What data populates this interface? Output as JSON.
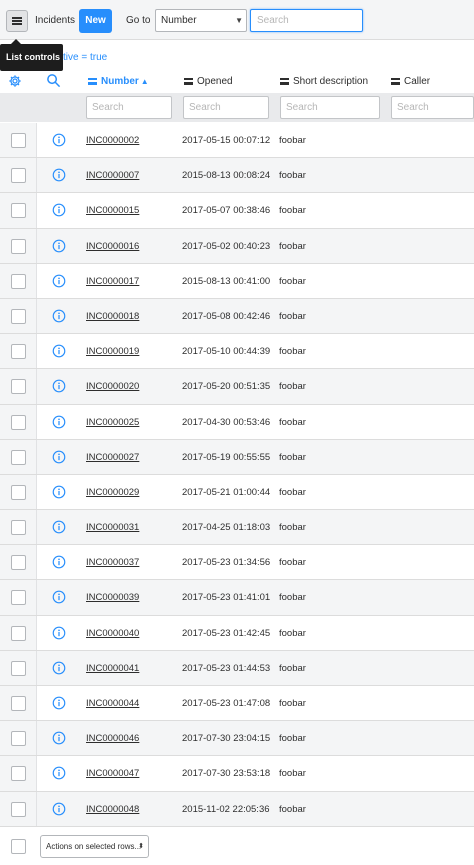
{
  "header": {
    "title": "Incidents",
    "new_label": "New",
    "goto_label": "Go to",
    "goto_field": "Number",
    "search_placeholder": "Search"
  },
  "tooltip": {
    "text": "List controls"
  },
  "filter": {
    "text": "ctive = true"
  },
  "columns": {
    "number": "Number",
    "opened": "Opened",
    "short_description": "Short description",
    "caller": "Caller"
  },
  "column_search_placeholder": "Search",
  "rows": [
    {
      "number": "INC0000002",
      "opened": "2017-05-15 00:07:12",
      "desc": "foobar",
      "caller": ""
    },
    {
      "number": "INC0000007",
      "opened": "2015-08-13 00:08:24",
      "desc": "foobar",
      "caller": ""
    },
    {
      "number": "INC0000015",
      "opened": "2017-05-07 00:38:46",
      "desc": "foobar",
      "caller": ""
    },
    {
      "number": "INC0000016",
      "opened": "2017-05-02 00:40:23",
      "desc": "foobar",
      "caller": ""
    },
    {
      "number": "INC0000017",
      "opened": "2015-08-13 00:41:00",
      "desc": "foobar",
      "caller": ""
    },
    {
      "number": "INC0000018",
      "opened": "2017-05-08 00:42:46",
      "desc": "foobar",
      "caller": ""
    },
    {
      "number": "INC0000019",
      "opened": "2017-05-10 00:44:39",
      "desc": "foobar",
      "caller": ""
    },
    {
      "number": "INC0000020",
      "opened": "2017-05-20 00:51:35",
      "desc": "foobar",
      "caller": ""
    },
    {
      "number": "INC0000025",
      "opened": "2017-04-30 00:53:46",
      "desc": "foobar",
      "caller": ""
    },
    {
      "number": "INC0000027",
      "opened": "2017-05-19 00:55:55",
      "desc": "foobar",
      "caller": ""
    },
    {
      "number": "INC0000029",
      "opened": "2017-05-21 01:00:44",
      "desc": "foobar",
      "caller": ""
    },
    {
      "number": "INC0000031",
      "opened": "2017-04-25 01:18:03",
      "desc": "foobar",
      "caller": ""
    },
    {
      "number": "INC0000037",
      "opened": "2017-05-23 01:34:56",
      "desc": "foobar",
      "caller": ""
    },
    {
      "number": "INC0000039",
      "opened": "2017-05-23 01:41:01",
      "desc": "foobar",
      "caller": ""
    },
    {
      "number": "INC0000040",
      "opened": "2017-05-23 01:42:45",
      "desc": "foobar",
      "caller": ""
    },
    {
      "number": "INC0000041",
      "opened": "2017-05-23 01:44:53",
      "desc": "foobar",
      "caller": ""
    },
    {
      "number": "INC0000044",
      "opened": "2017-05-23 01:47:08",
      "desc": "foobar",
      "caller": ""
    },
    {
      "number": "INC0000046",
      "opened": "2017-07-30 23:04:15",
      "desc": "foobar",
      "caller": ""
    },
    {
      "number": "INC0000047",
      "opened": "2017-07-30 23:53:18",
      "desc": "foobar",
      "caller": ""
    },
    {
      "number": "INC0000048",
      "opened": "2015-11-02 22:05:36",
      "desc": "foobar",
      "caller": ""
    }
  ],
  "footer": {
    "actions_label": "Actions on selected rows..."
  },
  "icons": {
    "list_controls": "hamburger-menu-icon",
    "personalize": "gear-icon",
    "search_toggle": "search-icon",
    "row_info": "info-circle-icon",
    "sort": "sort-ascending-icon"
  },
  "colors": {
    "accent": "#278efc",
    "header_bg": "#f4f5f6",
    "tooltip_bg": "#1d1d1d"
  }
}
